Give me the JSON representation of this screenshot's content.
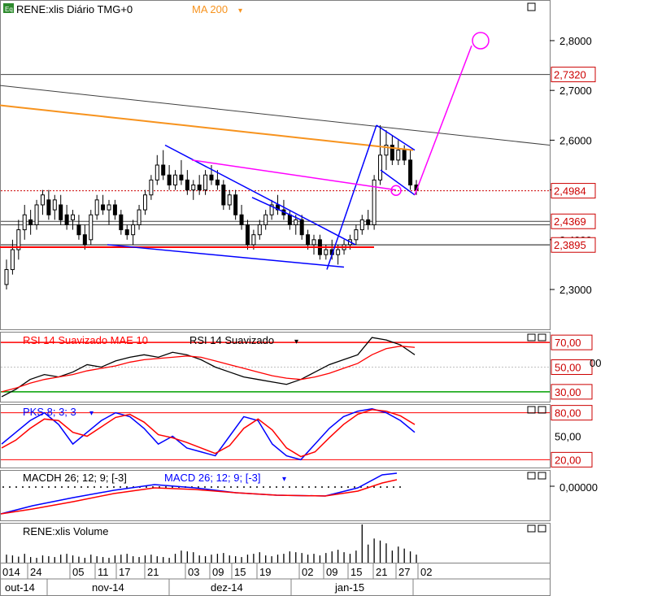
{
  "header": {
    "icon": "Eq",
    "symbol": "RENE:xlis Diário TMG+0",
    "ma_label": "MA 200",
    "ma_arrow": "▾"
  },
  "colors": {
    "up": "#000000",
    "down": "#000000",
    "ma": "#f7931e",
    "blue": "#0000ff",
    "magenta": "#ff00ff",
    "red": "#ff0000",
    "green": "#00a000",
    "gray": "#808080",
    "priceline": "#cc0000"
  },
  "price_axis": {
    "min": 2.22,
    "max": 2.88,
    "ticks": [
      "2,8000",
      "2,7000",
      "2,6000",
      "2,5000",
      "2,4000",
      "2,3000"
    ],
    "tick_values": [
      2.8,
      2.7,
      2.6,
      2.5,
      2.4,
      2.3
    ],
    "boxed": [
      {
        "label": "2,7320",
        "value": 2.732
      },
      {
        "label": "2,4984",
        "value": 2.4984
      },
      {
        "label": "2,4369",
        "value": 2.4369
      },
      {
        "label": "2,3895",
        "value": 2.3895
      }
    ]
  },
  "horizontal_levels": [
    2.732,
    2.4984,
    2.4369,
    2.3895,
    2.43,
    2.39
  ],
  "rsi": {
    "label1": "RSI 14 Suavizado MAE 10",
    "label2": "RSI 14 Suavizado",
    "arrow": "▾",
    "levels": [
      "70,00",
      "50,00",
      "30,00"
    ],
    "level_values": [
      70,
      50,
      30
    ],
    "extra_tick": "00",
    "range": [
      22,
      78
    ]
  },
  "stoch": {
    "label": "PKS 8; 3; 3",
    "arrow": "▾",
    "levels": [
      "80,00",
      "50,00",
      "20,00"
    ],
    "level_values": [
      80,
      50,
      20
    ],
    "range": [
      10,
      90
    ]
  },
  "macd": {
    "label1": "MACDH 26; 12; 9; [-3]",
    "label2": "MACD 26; 12; 9; [-3]",
    "arrow": "▾",
    "level": "0,00000"
  },
  "volume": {
    "label": "RENE:xlis Volume"
  },
  "x_axis": {
    "days": [
      "014",
      "24",
      "05",
      "11",
      "17",
      "21",
      "03",
      "09",
      "15",
      "19",
      "02",
      "09",
      "15",
      "21",
      "27",
      "02"
    ],
    "months": [
      "out-14",
      "nov-14",
      "dez-14",
      "jan-15"
    ]
  },
  "chart_data": {
    "type": "candlestick",
    "title": "RENE:xlis Diário TMG+0",
    "series": [
      {
        "name": "RENE:xlis",
        "kind": "ohlc"
      },
      {
        "name": "MA 200",
        "kind": "line"
      }
    ],
    "candles": [
      [
        2.31,
        2.36,
        2.3,
        2.34
      ],
      [
        2.34,
        2.4,
        2.33,
        2.38
      ],
      [
        2.38,
        2.44,
        2.36,
        2.42
      ],
      [
        2.42,
        2.47,
        2.4,
        2.45
      ],
      [
        2.44,
        2.46,
        2.41,
        2.43
      ],
      [
        2.43,
        2.48,
        2.42,
        2.47
      ],
      [
        2.47,
        2.5,
        2.45,
        2.49
      ],
      [
        2.48,
        2.5,
        2.44,
        2.45
      ],
      [
        2.46,
        2.49,
        2.44,
        2.48
      ],
      [
        2.47,
        2.49,
        2.43,
        2.44
      ],
      [
        2.45,
        2.47,
        2.42,
        2.43
      ],
      [
        2.44,
        2.46,
        2.42,
        2.45
      ],
      [
        2.43,
        2.45,
        2.4,
        2.41
      ],
      [
        2.41,
        2.43,
        2.38,
        2.39
      ],
      [
        2.4,
        2.46,
        2.39,
        2.45
      ],
      [
        2.45,
        2.49,
        2.44,
        2.48
      ],
      [
        2.47,
        2.49,
        2.45,
        2.46
      ],
      [
        2.46,
        2.48,
        2.43,
        2.47
      ],
      [
        2.47,
        2.48,
        2.44,
        2.45
      ],
      [
        2.45,
        2.46,
        2.41,
        2.42
      ],
      [
        2.42,
        2.43,
        2.4,
        2.41
      ],
      [
        2.41,
        2.44,
        2.39,
        2.43
      ],
      [
        2.43,
        2.47,
        2.42,
        2.46
      ],
      [
        2.46,
        2.5,
        2.45,
        2.49
      ],
      [
        2.49,
        2.53,
        2.48,
        2.52
      ],
      [
        2.52,
        2.57,
        2.51,
        2.55
      ],
      [
        2.55,
        2.58,
        2.52,
        2.53
      ],
      [
        2.53,
        2.55,
        2.5,
        2.51
      ],
      [
        2.51,
        2.54,
        2.5,
        2.53
      ],
      [
        2.53,
        2.56,
        2.51,
        2.52
      ],
      [
        2.52,
        2.54,
        2.49,
        2.5
      ],
      [
        2.5,
        2.52,
        2.48,
        2.51
      ],
      [
        2.51,
        2.53,
        2.49,
        2.5
      ],
      [
        2.5,
        2.54,
        2.49,
        2.53
      ],
      [
        2.53,
        2.55,
        2.51,
        2.52
      ],
      [
        2.52,
        2.54,
        2.5,
        2.51
      ],
      [
        2.51,
        2.52,
        2.46,
        2.47
      ],
      [
        2.47,
        2.5,
        2.46,
        2.49
      ],
      [
        2.49,
        2.5,
        2.44,
        2.45
      ],
      [
        2.45,
        2.47,
        2.42,
        2.43
      ],
      [
        2.43,
        2.44,
        2.38,
        2.39
      ],
      [
        2.39,
        2.42,
        2.38,
        2.41
      ],
      [
        2.41,
        2.44,
        2.4,
        2.43
      ],
      [
        2.43,
        2.46,
        2.42,
        2.45
      ],
      [
        2.45,
        2.48,
        2.44,
        2.47
      ],
      [
        2.47,
        2.49,
        2.45,
        2.46
      ],
      [
        2.46,
        2.48,
        2.44,
        2.45
      ],
      [
        2.45,
        2.46,
        2.42,
        2.43
      ],
      [
        2.43,
        2.45,
        2.41,
        2.44
      ],
      [
        2.44,
        2.45,
        2.4,
        2.41
      ],
      [
        2.41,
        2.42,
        2.38,
        2.39
      ],
      [
        2.39,
        2.41,
        2.37,
        2.4
      ],
      [
        2.4,
        2.41,
        2.36,
        2.37
      ],
      [
        2.37,
        2.39,
        2.36,
        2.38
      ],
      [
        2.38,
        2.4,
        2.36,
        2.37
      ],
      [
        2.37,
        2.39,
        2.35,
        2.38
      ],
      [
        2.38,
        2.4,
        2.37,
        2.39
      ],
      [
        2.39,
        2.41,
        2.38,
        2.4
      ],
      [
        2.4,
        2.43,
        2.39,
        2.42
      ],
      [
        2.42,
        2.45,
        2.41,
        2.44
      ],
      [
        2.44,
        2.46,
        2.42,
        2.43
      ],
      [
        2.43,
        2.53,
        2.42,
        2.52
      ],
      [
        2.52,
        2.63,
        2.51,
        2.57
      ],
      [
        2.57,
        2.62,
        2.54,
        2.59
      ],
      [
        2.59,
        2.61,
        2.55,
        2.56
      ],
      [
        2.56,
        2.6,
        2.55,
        2.58
      ],
      [
        2.58,
        2.59,
        2.55,
        2.56
      ],
      [
        2.56,
        2.58,
        2.5,
        2.51
      ],
      [
        2.51,
        2.52,
        2.49,
        2.5
      ]
    ],
    "ma200": [
      2.67,
      2.665,
      2.66,
      2.655,
      2.65,
      2.645,
      2.64,
      2.635,
      2.63,
      2.625,
      2.62,
      2.615,
      2.61,
      2.605,
      2.6,
      2.595,
      2.59,
      2.585,
      2.58
    ],
    "rsi": [
      26,
      32,
      40,
      44,
      42,
      46,
      52,
      50,
      55,
      58,
      60,
      58,
      62,
      60,
      56,
      50,
      46,
      42,
      40,
      38,
      36,
      40,
      46,
      52,
      56,
      60,
      74,
      72,
      68,
      60
    ],
    "rsi_smooth": [
      30,
      33,
      37,
      40,
      42,
      44,
      47,
      49,
      51,
      54,
      56,
      57,
      58,
      59,
      58,
      55,
      52,
      49,
      46,
      43,
      41,
      40,
      42,
      45,
      49,
      53,
      60,
      65,
      67,
      66
    ],
    "stoch_k": [
      40,
      55,
      70,
      80,
      65,
      40,
      55,
      70,
      80,
      75,
      60,
      40,
      50,
      35,
      30,
      25,
      50,
      75,
      70,
      40,
      25,
      20,
      40,
      60,
      75,
      82,
      85,
      80,
      70,
      55
    ],
    "stoch_d": [
      35,
      45,
      60,
      72,
      70,
      55,
      50,
      62,
      74,
      78,
      68,
      52,
      48,
      42,
      35,
      28,
      38,
      60,
      72,
      58,
      35,
      24,
      30,
      48,
      65,
      78,
      84,
      82,
      76,
      65
    ],
    "volume": [
      20,
      18,
      15,
      22,
      14,
      12,
      18,
      16,
      14,
      20,
      22,
      18,
      15,
      12,
      20,
      16,
      14,
      12,
      18,
      20,
      22,
      16,
      14,
      18,
      20,
      16,
      14,
      12,
      22,
      30,
      28,
      26,
      18,
      16,
      20,
      22,
      24,
      18,
      16,
      14,
      20,
      22,
      26,
      18,
      16,
      20,
      22,
      28,
      26,
      24,
      20,
      22,
      18,
      24,
      28,
      32,
      26,
      22,
      30,
      95,
      45,
      60,
      55,
      48,
      30,
      40,
      35,
      28,
      20
    ]
  }
}
